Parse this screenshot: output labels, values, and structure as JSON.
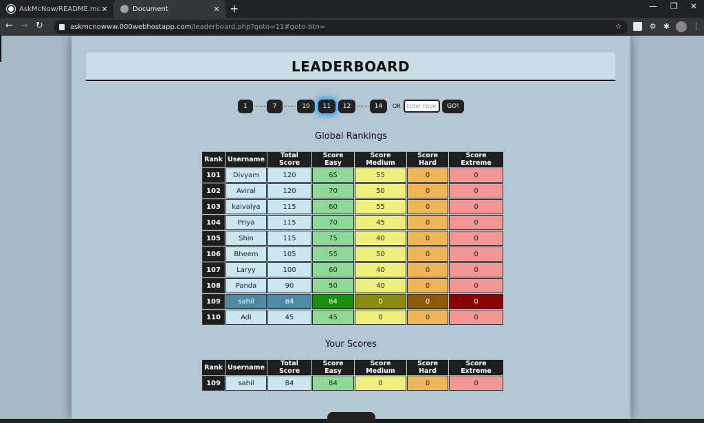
{
  "browser": {
    "tabs": [
      {
        "title": "AskMcNow/README.md at mast",
        "active": false
      },
      {
        "title": "Document",
        "active": true
      }
    ],
    "url_host": "askmcnowww.000webhostapp.com",
    "url_path": "/leaderboard.php?goto=11#goto-btn="
  },
  "page": {
    "title": "LEADERBOARD",
    "pagination": {
      "pages": [
        "1",
        "7",
        "10",
        "11",
        "12",
        "14"
      ],
      "current": "11",
      "or_label": "OR",
      "input_placeholder": "Enter Page",
      "go_label": "GO!"
    },
    "global_title": "Global Rankings",
    "your_title": "Your Scores",
    "columns": [
      "Rank",
      "Username",
      "Total Score",
      "Score Easy",
      "Score Medium",
      "Score Hard",
      "Score Extreme"
    ],
    "rows": [
      {
        "rank": "101",
        "username": "Divyam",
        "total": "120",
        "easy": "65",
        "medium": "55",
        "hard": "0",
        "extreme": "0"
      },
      {
        "rank": "102",
        "username": "Aviral",
        "total": "120",
        "easy": "70",
        "medium": "50",
        "hard": "0",
        "extreme": "0"
      },
      {
        "rank": "103",
        "username": "kaivalya",
        "total": "115",
        "easy": "60",
        "medium": "55",
        "hard": "0",
        "extreme": "0"
      },
      {
        "rank": "104",
        "username": "Priya",
        "total": "115",
        "easy": "70",
        "medium": "45",
        "hard": "0",
        "extreme": "0"
      },
      {
        "rank": "105",
        "username": "Shin",
        "total": "115",
        "easy": "75",
        "medium": "40",
        "hard": "0",
        "extreme": "0"
      },
      {
        "rank": "106",
        "username": "Bheem",
        "total": "105",
        "easy": "55",
        "medium": "50",
        "hard": "0",
        "extreme": "0"
      },
      {
        "rank": "107",
        "username": "Laryy",
        "total": "100",
        "easy": "60",
        "medium": "40",
        "hard": "0",
        "extreme": "0"
      },
      {
        "rank": "108",
        "username": "Panda",
        "total": "90",
        "easy": "50",
        "medium": "40",
        "hard": "0",
        "extreme": "0"
      },
      {
        "rank": "109",
        "username": "sahil",
        "total": "84",
        "easy": "84",
        "medium": "0",
        "hard": "0",
        "extreme": "0"
      },
      {
        "rank": "110",
        "username": "Adi",
        "total": "45",
        "easy": "45",
        "medium": "0",
        "hard": "0",
        "extreme": "0"
      }
    ],
    "highlight_rank": "109",
    "your_row": {
      "rank": "109",
      "username": "sahil",
      "total": "84",
      "easy": "84",
      "medium": "0",
      "hard": "0",
      "extreme": "0"
    }
  }
}
